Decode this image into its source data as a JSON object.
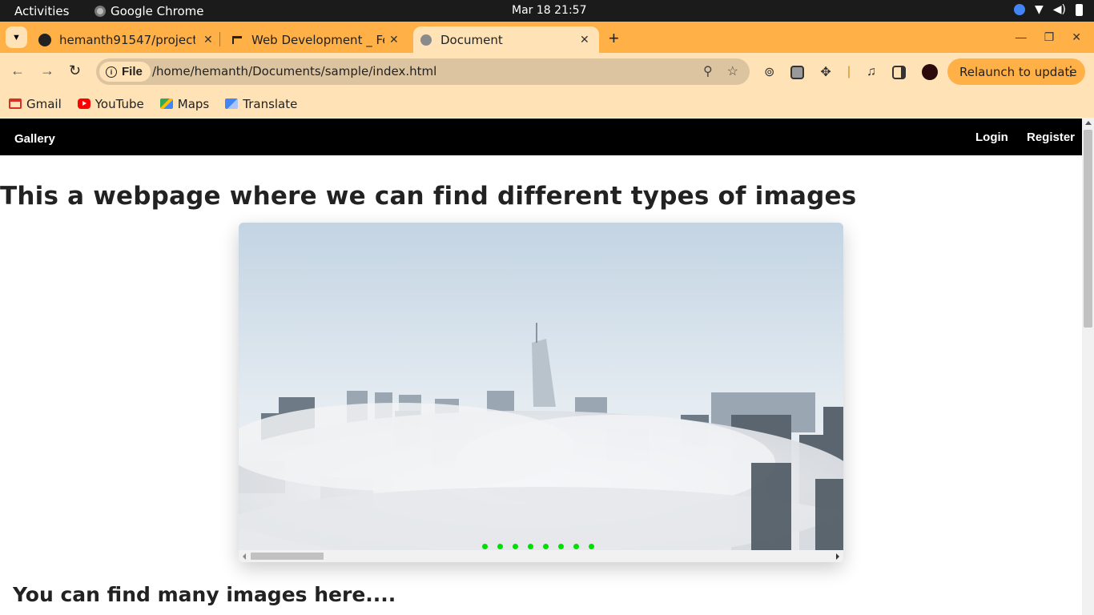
{
  "system_bar": {
    "activities": "Activities",
    "app_name": "Google Chrome",
    "clock": "Mar 18  21:57"
  },
  "tabs": [
    {
      "title": "hemanth91547/project",
      "icon": "github-icon",
      "active": false
    },
    {
      "title": "Web Development _ Feb",
      "icon": "web-dev-icon",
      "active": false
    },
    {
      "title": "Document",
      "icon": "globe-icon",
      "active": true
    }
  ],
  "toolbar": {
    "chip_label": "File",
    "url": "/home/hemanth/Documents/sample/index.html",
    "relaunch_label": "Relaunch to update"
  },
  "bookmarks": [
    {
      "label": "Gmail",
      "icon": "gmail-icon",
      "color": "#d93025"
    },
    {
      "label": "YouTube",
      "icon": "youtube-icon",
      "color": "#ff0000"
    },
    {
      "label": "Maps",
      "icon": "maps-icon",
      "color": "#34a853"
    },
    {
      "label": "Translate",
      "icon": "translate-icon",
      "color": "#4285f4"
    }
  ],
  "site": {
    "brand": "Gallery",
    "login": "Login",
    "register": "Register",
    "heading": "This a webpage where we can find different types of images",
    "subheading": "You can find many images here....",
    "carousel_dots": 8,
    "dot_color": "#00e000"
  },
  "colors": {
    "tabstrip": "#ffb046",
    "toolbar": "#ffe2b5",
    "navbar": "#000000"
  }
}
